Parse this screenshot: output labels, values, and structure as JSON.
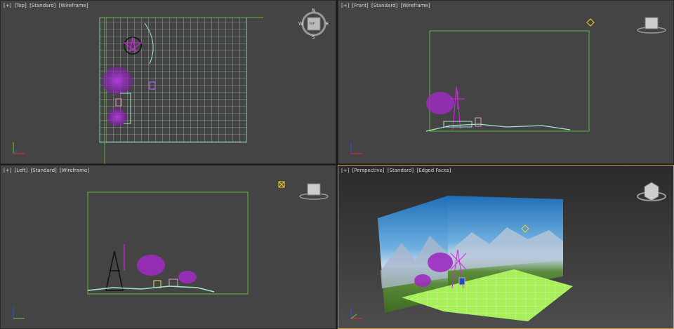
{
  "viewports": {
    "top": {
      "plus": "[+]",
      "view": "[Top]",
      "shading": "[Standard]",
      "mode": "[Wireframe]",
      "compass": {
        "n": "N",
        "s": "S",
        "e": "E",
        "w": "W",
        "cube": "TOP"
      }
    },
    "front": {
      "plus": "[+]",
      "view": "[Front]",
      "shading": "[Standard]",
      "mode": "[Wireframe]",
      "cube": "FRONT"
    },
    "left": {
      "plus": "[+]",
      "view": "[Left]",
      "shading": "[Standard]",
      "mode": "[Wireframe]",
      "cube": "LEFT"
    },
    "perspective": {
      "plus": "[+]",
      "view": "[Perspective]",
      "shading": "[Standard]",
      "mode": "[Edged Faces]"
    }
  },
  "colors": {
    "viewport_bg": "#444444",
    "active_border": "#c8a04a",
    "wire_grid": "#9fe8c8",
    "frame": "#5fb83a",
    "foliage": "#9c2cc0",
    "selection": "#e01ff0"
  },
  "icons": [
    "viewcube-icon",
    "axis-tripod-icon",
    "light-icon",
    "camera-target-icon"
  ]
}
